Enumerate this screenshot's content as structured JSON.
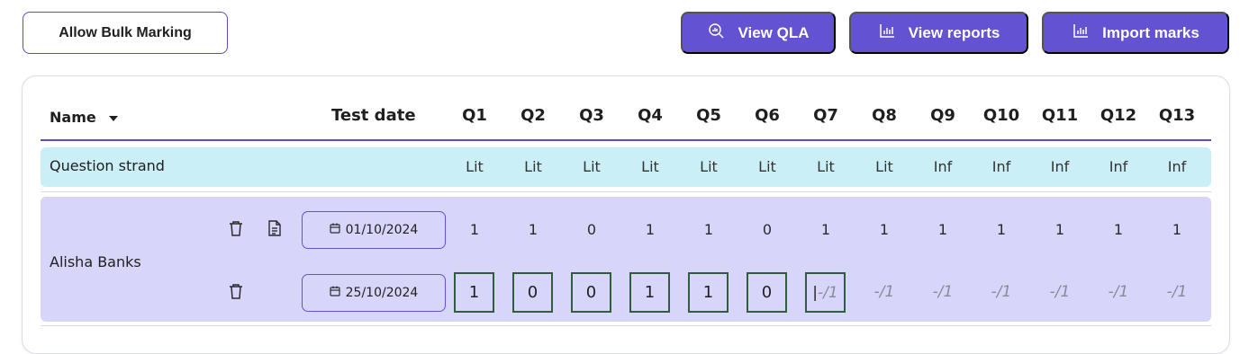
{
  "toolbar": {
    "bulk_label": "Allow Bulk Marking",
    "qla_label": "View QLA",
    "reports_label": "View reports",
    "import_label": "Import marks"
  },
  "table": {
    "name_header": "Name",
    "date_header": "Test date",
    "questions": [
      "Q1",
      "Q2",
      "Q3",
      "Q4",
      "Q5",
      "Q6",
      "Q7",
      "Q8",
      "Q9",
      "Q10",
      "Q11",
      "Q12",
      "Q13"
    ],
    "strand_label": "Question strand",
    "strands": [
      "Lit",
      "Lit",
      "Lit",
      "Lit",
      "Lit",
      "Lit",
      "Lit",
      "Lit",
      "Inf",
      "Inf",
      "Inf",
      "Inf",
      "Inf"
    ]
  },
  "student": {
    "name": "Alisha Banks",
    "attempts": [
      {
        "date": "01/10/2024",
        "marks": [
          "1",
          "1",
          "0",
          "1",
          "1",
          "0",
          "1",
          "1",
          "1",
          "1",
          "1",
          "1",
          "1"
        ]
      },
      {
        "date": "25/10/2024",
        "marks": [
          "1",
          "0",
          "0",
          "1",
          "1",
          "0",
          "",
          null,
          null,
          null,
          null,
          null,
          null
        ],
        "placeholder": "-/1",
        "active_input": "Q7"
      }
    ]
  },
  "colors": {
    "accent": "#6352d1",
    "strand_row": "#cbeff6",
    "student_row": "#d8d5fb",
    "input_border": "#2e5e3e"
  }
}
